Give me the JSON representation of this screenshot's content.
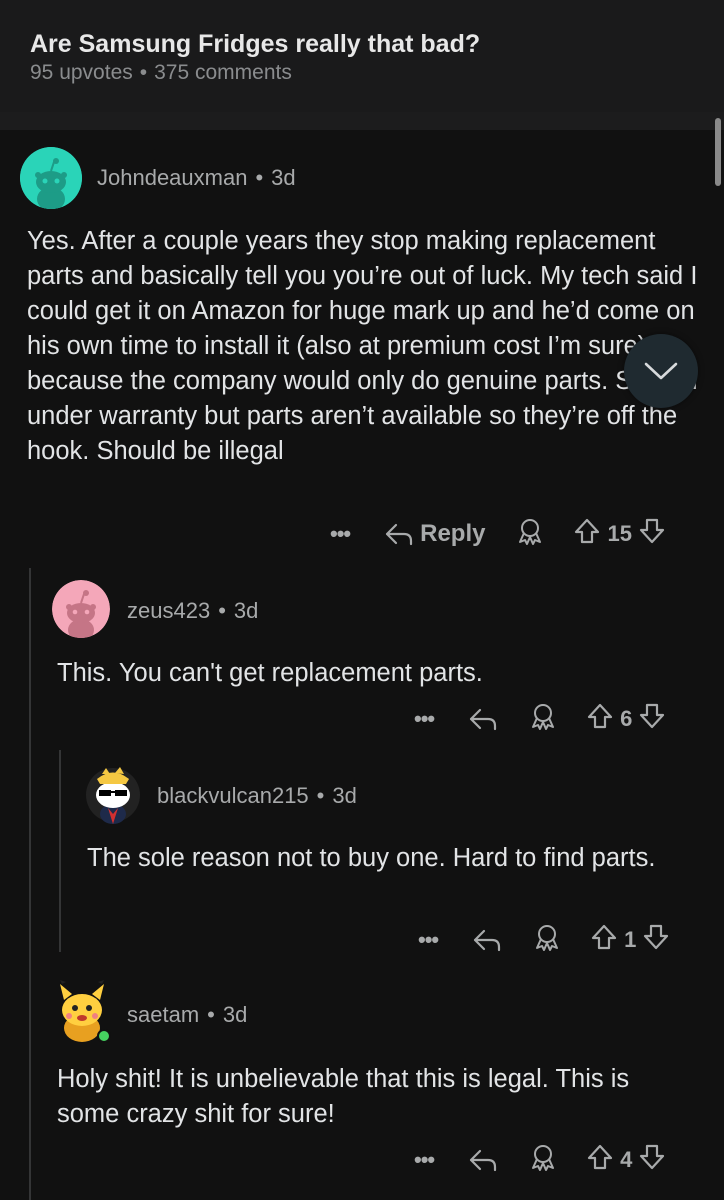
{
  "post": {
    "title": "Are Samsung Fridges really that bad?",
    "upvotes": "95 upvotes",
    "separator": "•",
    "comments": "375 comments"
  },
  "comments": [
    {
      "author": "Johndeauxman",
      "age": "3d",
      "body": "Yes. After a couple years they stop making replacement parts and basically tell you you’re out of luck. My tech said I could get it on Amazon for huge mark up and he’d come on his own time to install it (also at premium cost I’m sure) because the company would only do genuine parts. So, still under warranty but parts aren’t available so they’re off the hook. Should be illegal",
      "reply_label": "Reply",
      "score": "15",
      "avatar_color": "#2ad4b8"
    },
    {
      "author": "zeus423",
      "age": "3d",
      "body": "This. You can't get replacement parts.",
      "score": "6",
      "avatar_color": "#f4a7b9"
    },
    {
      "author": "blackvulcan215",
      "age": "3d",
      "body": "The sole reason not to buy one.  Hard to find parts.",
      "score": "1",
      "avatar_color": "#ffffff"
    },
    {
      "author": "saetam",
      "age": "3d",
      "body": "Holy shit! It is unbelievable that this is legal. This is some crazy shit for sure!",
      "score": "4",
      "avatar_color": "#ffcf40"
    }
  ],
  "ui": {
    "more_glyph": "•••",
    "dot": "•",
    "icons": [
      "reply-arrow-icon",
      "award-icon",
      "upvote-arrow-icon",
      "downvote-arrow-icon",
      "chevron-down-icon"
    ],
    "accent": "#46d160"
  }
}
